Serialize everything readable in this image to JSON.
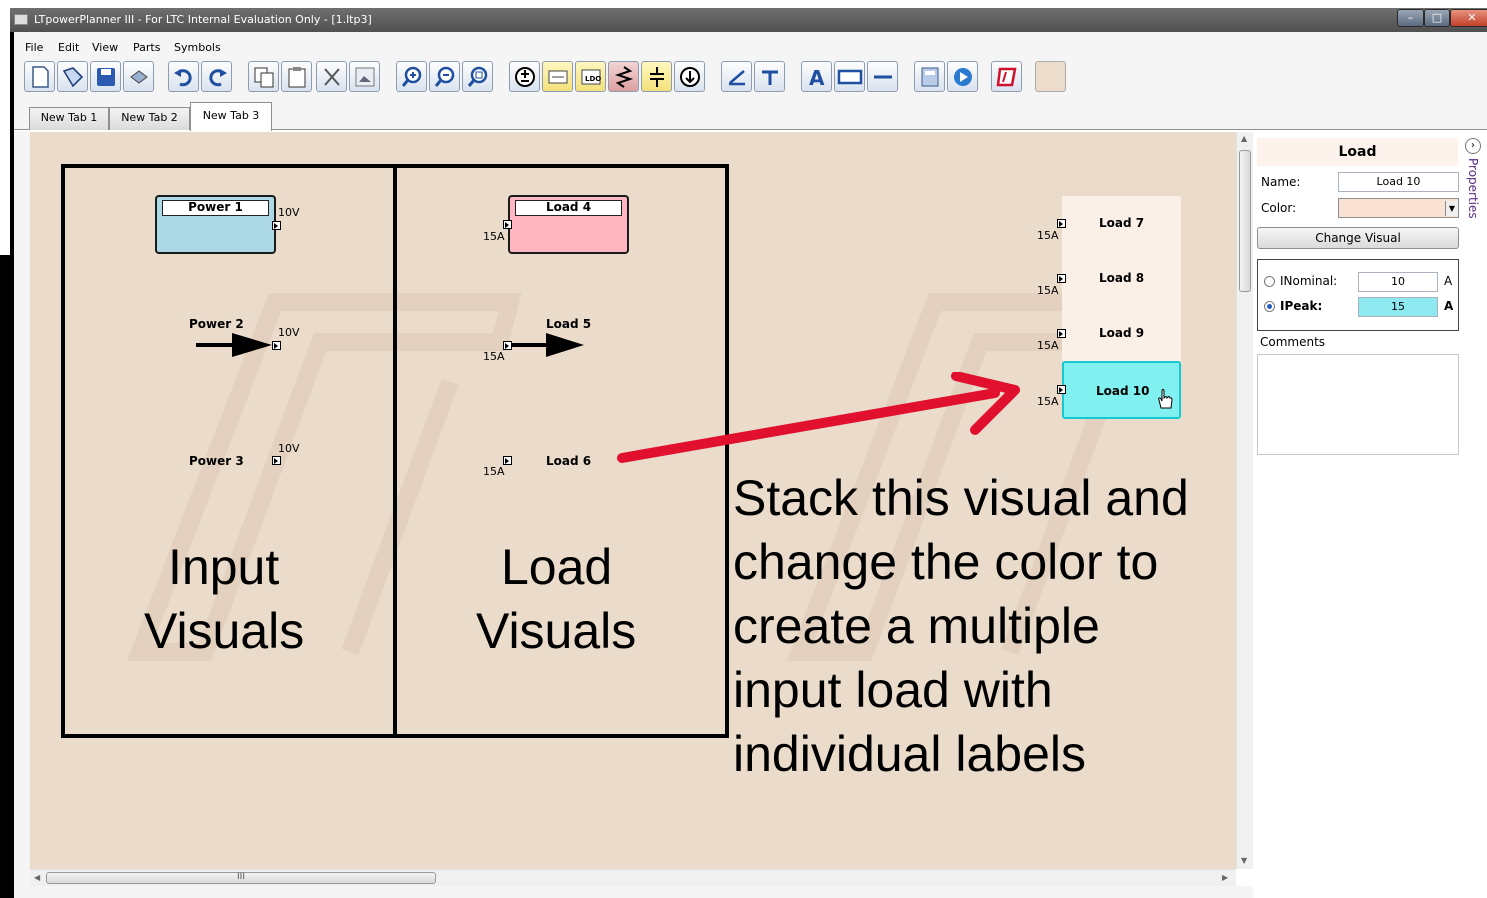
{
  "window": {
    "title": "LTpowerPlanner III - For LTC Internal Evaluation Only - [1.ltp3]",
    "controls": {
      "minimize": "–",
      "maximize": "□",
      "close": "✕"
    }
  },
  "menu": [
    "File",
    "Edit",
    "View",
    "Parts",
    "Symbols"
  ],
  "toolbar": {
    "buttons": [
      "new-document",
      "open",
      "save",
      "print",
      "undo",
      "redo",
      "copy",
      "paste",
      "cut",
      "image",
      "zoom-in",
      "zoom-out",
      "zoom-fit",
      "add-power-source",
      "add-converter",
      "add-ldo",
      "add-resistor",
      "add-capacitor",
      "add-load",
      "add-line",
      "add-connector",
      "add-text",
      "add-rectangle",
      "add-divider",
      "calculate",
      "run",
      "logo",
      "color-swatch"
    ]
  },
  "tabs": [
    "New Tab 1",
    "New Tab 2",
    "New Tab 3"
  ],
  "active_tab": "New Tab 3",
  "canvas": {
    "inputs": [
      {
        "label": "Power 1",
        "voltage": "10V"
      },
      {
        "label": "Power 2",
        "voltage": "10V"
      },
      {
        "label": "Power 3",
        "voltage": "10V"
      }
    ],
    "loads": [
      {
        "label": "Load 4",
        "current": "15A"
      },
      {
        "label": "Load 5",
        "current": "15A"
      },
      {
        "label": "Load 6",
        "current": "15A"
      }
    ],
    "stack": [
      {
        "label": "Load 7",
        "current": "15A"
      },
      {
        "label": "Load 8",
        "current": "15A"
      },
      {
        "label": "Load 9",
        "current": "15A"
      },
      {
        "label": "Load 10",
        "current": "15A"
      }
    ],
    "input_caption": [
      "Input",
      "Visuals"
    ],
    "load_caption": [
      "Load",
      "Visuals"
    ],
    "annotation": [
      "Stack this visual and",
      "change the color to",
      "create a multiple",
      "input load with",
      "individual labels"
    ],
    "colors": {
      "background": "#eadbcb",
      "power_fill": "#add8e6",
      "load_fill": "#ffb6c1",
      "selected_fill": "#80f0f0",
      "arrow": "#e0102e"
    }
  },
  "hscroll": {
    "thumb": "III"
  },
  "properties": {
    "header": "Load",
    "name_label": "Name:",
    "name_value": "Load 10",
    "color_label": "Color:",
    "color_value": "#fae3d4",
    "change_visual": "Change Visual",
    "inominal_label": "INominal:",
    "inominal_value": "10",
    "inominal_unit": "A",
    "ipeak_label": "IPeak:",
    "ipeak_value": "15",
    "ipeak_unit": "A",
    "current_mode": "IPeak",
    "comments_label": "Comments",
    "comments_value": "",
    "vertical_tab": "Properties"
  }
}
